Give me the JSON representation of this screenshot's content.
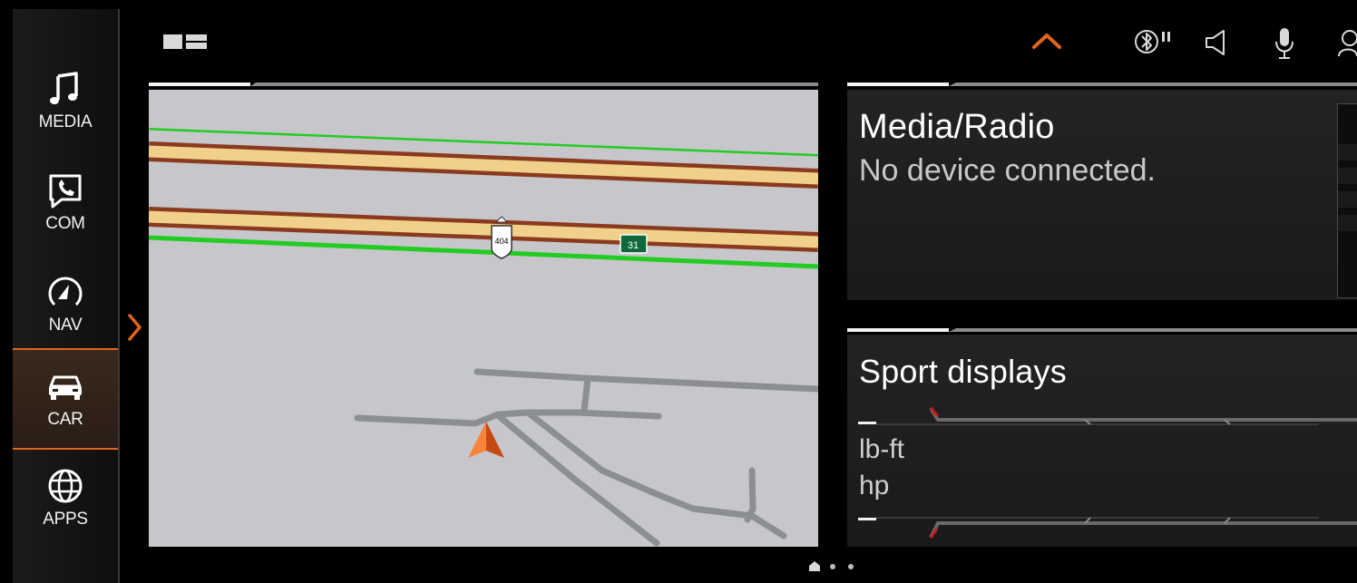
{
  "sidebar": {
    "items": [
      {
        "label": "MEDIA",
        "icon": "music-note-icon"
      },
      {
        "label": "COM",
        "icon": "phone-screen-icon"
      },
      {
        "label": "NAV",
        "icon": "navigation-arrow-icon"
      },
      {
        "label": "CAR",
        "icon": "car-icon",
        "active": true
      },
      {
        "label": "APPS",
        "icon": "globe-icon"
      }
    ]
  },
  "map": {
    "highway_shield": "404",
    "exit_sign": "31"
  },
  "media_panel": {
    "title": "Media/Radio",
    "subtitle": "No device connected."
  },
  "sport_panel": {
    "title": "Sport displays",
    "unit_torque": "lb-ft",
    "unit_power": "hp"
  },
  "status_bar": {
    "icons": [
      "chevron-up-icon",
      "bluetooth-icon",
      "speaker-icon",
      "microphone-icon",
      "user-icon"
    ]
  },
  "colors": {
    "accent": "#e0641e",
    "map_background": "#c7c7cb",
    "highway_fill": "#f0d08a",
    "highway_border": "#8a3a1e",
    "highway_traffic": "#22cc22"
  }
}
